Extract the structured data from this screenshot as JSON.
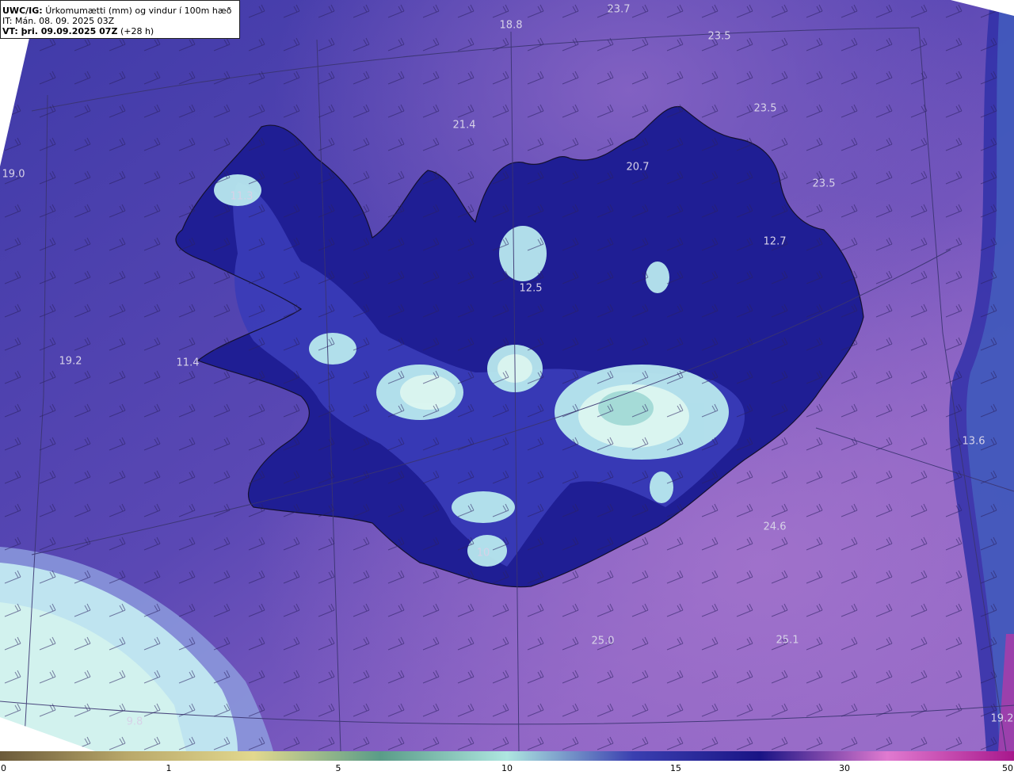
{
  "header": {
    "product": "UWC/IG:",
    "description": "Úrkomumætti (mm) og vindur í 100m hæð",
    "issue_time": "IT: Mán. 08. 09. 2025 03Z",
    "valid_prefix": "VT: þri. 09.09.2025 07Z",
    "valid_suffix": "(+28 h)"
  },
  "map_values": [
    {
      "text": "23.7"
    },
    {
      "text": "18.8"
    },
    {
      "text": "23.5"
    },
    {
      "text": "23.5"
    },
    {
      "text": "21.4"
    },
    {
      "text": "20.7"
    },
    {
      "text": "23.5"
    },
    {
      "text": "19.0"
    },
    {
      "text": "11.3"
    },
    {
      "text": "12.7"
    },
    {
      "text": "12.5"
    },
    {
      "text": "19.2"
    },
    {
      "text": "11.4"
    },
    {
      "text": "13.6"
    },
    {
      "text": "24.6"
    },
    {
      "text": "10"
    },
    {
      "text": "25.0"
    },
    {
      "text": "25.1"
    },
    {
      "text": "9.8"
    },
    {
      "text": "19.2"
    }
  ],
  "colorbar": {
    "ticks": [
      "0",
      "1",
      "5",
      "10",
      "15",
      "30",
      "50"
    ],
    "colors": [
      "#6b5a3a",
      "#b9a86a",
      "#e2d88e",
      "#5a9c88",
      "#aee6e0",
      "#3a3fb0",
      "#1a1485",
      "#e07ad0",
      "#a8188c"
    ]
  },
  "colors": {
    "ocean_base": "#4a3aa8",
    "ocean_light": "#7a5cbf",
    "land_dark": "#1e1c8c",
    "precip_high": "#c8f0ea"
  }
}
